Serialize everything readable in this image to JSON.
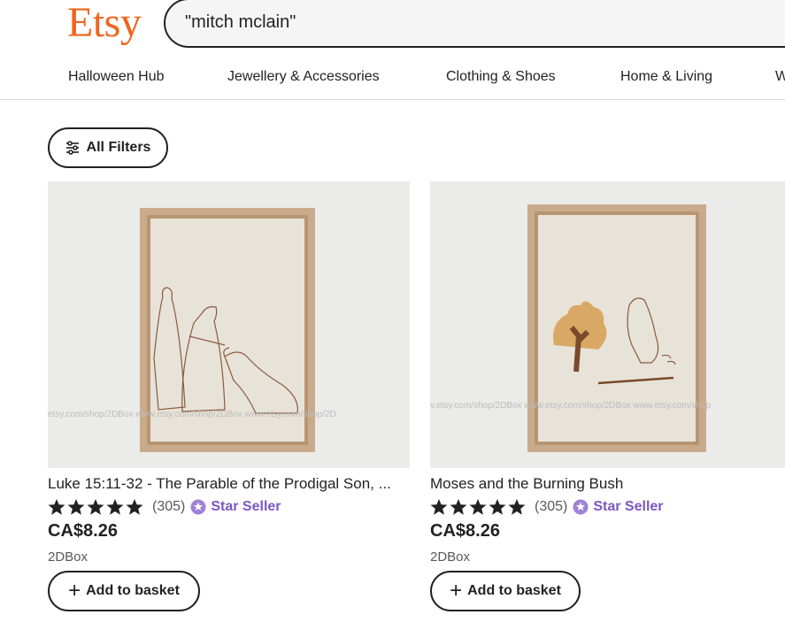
{
  "header": {
    "logo": "Etsy",
    "search_value": "\"mitch mclain\""
  },
  "nav": {
    "items": [
      "Halloween Hub",
      "Jewellery & Accessories",
      "Clothing & Shoes",
      "Home & Living",
      "W"
    ]
  },
  "filters": {
    "label": "All Filters"
  },
  "colors": {
    "brand": "#f1641e",
    "star_seller": "#7b57c2"
  },
  "products": [
    {
      "title": "Luke 15:11-32 - The Parable of the Prodigal Son, ...",
      "rating": 5,
      "reviews": "(305)",
      "badge": "Star Seller",
      "price": "CA$8.26",
      "shop": "2DBox",
      "button": "Add to basket",
      "watermark": "etsy.com/shop/2DBox  www.etsy.com/shop/2DBox  www.etsy.com/shop/2D"
    },
    {
      "title": "Moses and the Burning Bush",
      "rating": 5,
      "reviews": "(305)",
      "badge": "Star Seller",
      "price": "CA$8.26",
      "shop": "2DBox",
      "button": "Add to basket",
      "watermark": "v.etsy.com/shop/2DBox  www.etsy.com/shop/2DBox  www.etsy.com/shop"
    }
  ]
}
